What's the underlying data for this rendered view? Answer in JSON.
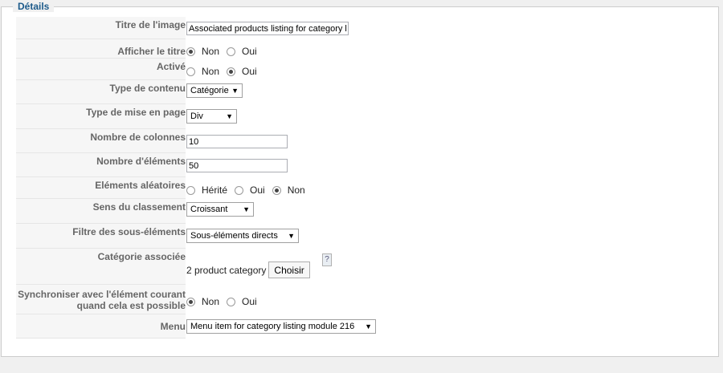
{
  "legend": "Détails",
  "rows": {
    "title_image": {
      "label": "Titre de l'image",
      "value": "Associated products listing for category l"
    },
    "show_title": {
      "label": "Afficher le titre",
      "options": [
        "Non",
        "Oui"
      ],
      "selected": "Non"
    },
    "active": {
      "label": "Activé",
      "options": [
        "Non",
        "Oui"
      ],
      "selected": "Oui"
    },
    "content_type": {
      "label": "Type de contenu",
      "value": "Catégorie"
    },
    "layout_type": {
      "label": "Type de mise en page",
      "value": "Div"
    },
    "columns": {
      "label": "Nombre de colonnes",
      "value": "10"
    },
    "elements": {
      "label": "Nombre d'éléments",
      "value": "50"
    },
    "random": {
      "label": "Eléments aléatoires",
      "options": [
        "Hérité",
        "Oui",
        "Non"
      ],
      "selected": "Non"
    },
    "sort": {
      "label": "Sens du classement",
      "value": "Croissant"
    },
    "sub_filter": {
      "label": "Filtre des sous-éléments",
      "value": "Sous-éléments directs"
    },
    "category": {
      "label": "Catégorie associée",
      "value": "2 product category",
      "button": "Choisir"
    },
    "sync": {
      "label_line1": "Synchroniser avec l'élément courant",
      "label_line2": "quand cela est possible",
      "options": [
        "Non",
        "Oui"
      ],
      "selected": "Non"
    },
    "menu": {
      "label": "Menu",
      "value": "Menu item for category listing module 216"
    }
  },
  "icons": {
    "help": "help-icon",
    "dropdown": "chevron-down-icon"
  }
}
